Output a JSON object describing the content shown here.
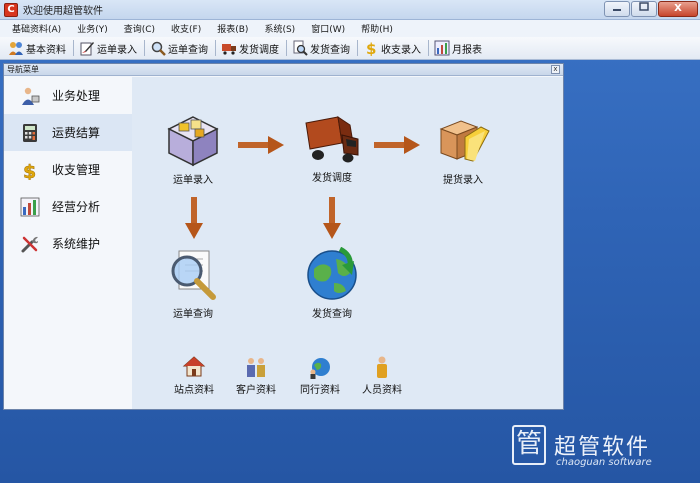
{
  "window": {
    "title": "欢迎使用超管软件",
    "app_icon": "C",
    "close_glyph": "X"
  },
  "menubar": [
    {
      "label": "基础资料(A)"
    },
    {
      "label": "业务(Y)"
    },
    {
      "label": "查询(C)"
    },
    {
      "label": "收支(F)"
    },
    {
      "label": "报表(B)"
    },
    {
      "label": "系统(S)"
    },
    {
      "label": "窗口(W)"
    },
    {
      "label": "帮助(H)"
    }
  ],
  "toolbar": [
    {
      "label": "基本资料",
      "icon": "people-icon"
    },
    {
      "label": "运单录入",
      "icon": "edit-icon"
    },
    {
      "label": "运单查询",
      "icon": "magnifier-icon"
    },
    {
      "label": "发货调度",
      "icon": "dispatch-icon"
    },
    {
      "label": "发货查询",
      "icon": "search-doc-icon"
    },
    {
      "label": "收支录入",
      "icon": "dollar-icon"
    },
    {
      "label": "月报表",
      "icon": "chart-icon"
    }
  ],
  "nav": {
    "title": "导航菜单",
    "close_glyph": "x",
    "sidebar": [
      {
        "label": "业务处理",
        "icon": "person-work-icon",
        "active": false
      },
      {
        "label": "运费结算",
        "icon": "calculator-icon",
        "active": true
      },
      {
        "label": "收支管理",
        "icon": "dollar-icon",
        "active": false
      },
      {
        "label": "经营分析",
        "icon": "bar-chart-icon",
        "active": false
      },
      {
        "label": "系统维护",
        "icon": "tools-icon",
        "active": false
      }
    ],
    "flow": {
      "waybill_entry": "运单录入",
      "dispatch": "发货调度",
      "pickup_entry": "提货录入",
      "waybill_query": "运单查询",
      "shipment_query": "发货查询"
    },
    "shortcuts": [
      {
        "label": "站点资料",
        "icon": "house-icon"
      },
      {
        "label": "客户资料",
        "icon": "customers-icon"
      },
      {
        "label": "同行资料",
        "icon": "globe-people-icon"
      },
      {
        "label": "人员资料",
        "icon": "person-icon"
      }
    ]
  },
  "brand": {
    "mark": "管",
    "name": "超管软件",
    "subtitle": "chaoguan software"
  },
  "colors": {
    "desktop": "#2f64b6",
    "arrow": "#b5561a",
    "content_bg": "#dfe9f5"
  }
}
